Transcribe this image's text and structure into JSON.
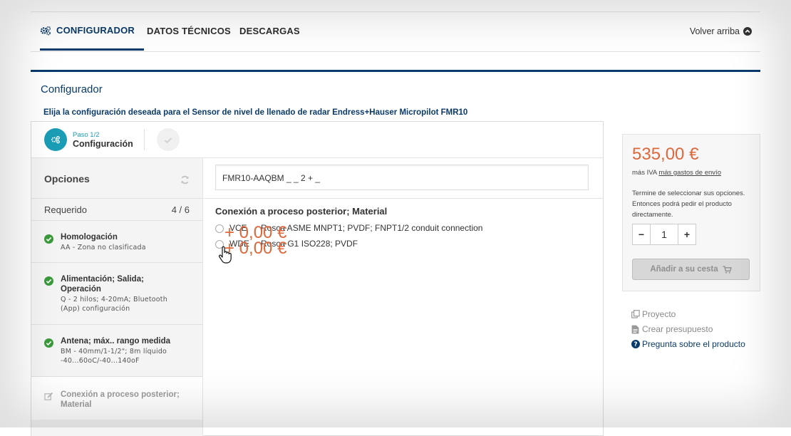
{
  "tabs": [
    {
      "label": "CONFIGURADOR",
      "icon": "cogs-icon",
      "active": true
    },
    {
      "label": "DATOS TÉCNICOS",
      "active": false
    },
    {
      "label": "DESCARGAS",
      "active": false
    }
  ],
  "back_to_top": {
    "label": "Volver arriba",
    "icon": "chevron-up-circle-icon"
  },
  "section_title": "Configurador",
  "intro_text": "Elija la configuración deseada para el Sensor de nivel de llenado de radar Endress+Hauser Micropilot FMR10",
  "steps": {
    "current_small": "Paso 1/2",
    "current_label": "Configuración"
  },
  "sidebar": {
    "title": "Opciones",
    "required_label": "Requerido",
    "required_count": "4 / 6",
    "items": [
      {
        "name": "Homologación",
        "value": "AA - Zona no clasificada",
        "status": "done"
      },
      {
        "name": "Alimentación; Salida; Operación",
        "value": "Q - 2 hilos; 4-20mA; Bluetooth (App) configuración",
        "status": "done"
      },
      {
        "name": "Antena; máx.. rango medida",
        "value": "BM - 40mm/1-1/2\"; 8m líquido -40...60oC/-40...140oF",
        "status": "done"
      },
      {
        "name": "Conexión a proceso posterior; Material",
        "value": "",
        "status": "editing"
      }
    ]
  },
  "order_code": "FMR10-AAQBM _ _ 2 + _",
  "option_group": {
    "title": "Conexión a proceso posterior; Material",
    "options": [
      {
        "code": "VCE",
        "description": "Rosca ASME MNPT1; PVDF; FNPT1/2 conduit connection",
        "price": "+ 0,00 €"
      },
      {
        "code": "WDE",
        "description": "Rosca G1 ISO228; PVDF",
        "price": "+ 0,00 €"
      }
    ]
  },
  "pricebox": {
    "price": "535,00 €",
    "vat_prefix": "más IVA",
    "shipping_link": "más gastos de envío",
    "note": "Termine de seleccionar sus opciones. Entonces podrá pedir el producto directamente.",
    "quantity": "1",
    "minus": "−",
    "plus": "+",
    "add_to_cart": "Añadir a su cesta"
  },
  "links": [
    {
      "label": "Proyecto",
      "icon": "copy-icon"
    },
    {
      "label": "Crear presupuesto",
      "icon": "document-icon"
    },
    {
      "label": "Pregunta sobre el producto",
      "icon": "question-circle-icon"
    }
  ],
  "colors": {
    "brand_navy": "#0a3b6b",
    "accent_teal": "#1a9db5",
    "price_orange": "#e0673a",
    "check_green": "#3a9a3a"
  }
}
